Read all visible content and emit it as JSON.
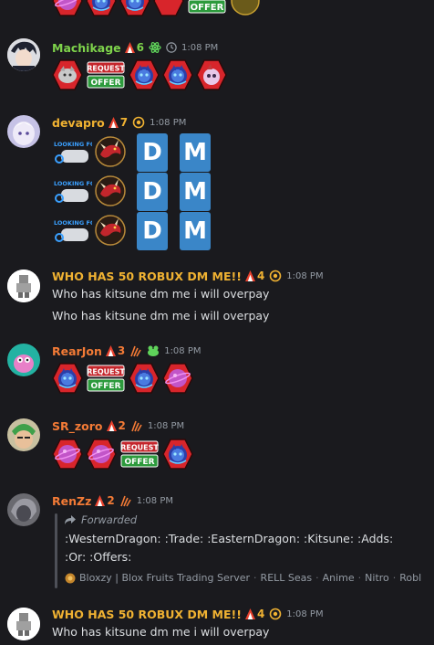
{
  "colors": {
    "background": "#1a1a1e",
    "green_user": "#7ed34b",
    "gold_user": "#f0b232",
    "orange_user": "#f47b36",
    "red_hex": "#d8252b",
    "dm_blue": "#3a86c8"
  },
  "top_row": {
    "offer_label": "OFFER"
  },
  "messages": [
    {
      "username": "Machikage",
      "level": "6",
      "time": "1:08 PM",
      "badges": [
        "atom-badge-icon",
        "clock-badge-icon"
      ],
      "emojis": [
        "fruit-emoji",
        "request-offer-emoji",
        "kitsune-emoji",
        "kitsune-emoji",
        "dough-emoji"
      ],
      "request_label": "REQUEST",
      "offer_label": "OFFER"
    },
    {
      "username": "devapro",
      "level": "7",
      "time": "1:08 PM",
      "lf_label": "LOOKING FOR",
      "dm_letters": [
        "D",
        "M"
      ]
    },
    {
      "username": "WHO HAS 50 ROBUX DM ME!!",
      "level": "4",
      "time": "1:08 PM",
      "line1": "Who has kitsune dm me i will overpay",
      "line2": "Who has kitsune dm me i will overpay"
    },
    {
      "username": "RearJon",
      "level": "3",
      "time": "1:08 PM",
      "request_label": "REQUEST",
      "offer_label": "OFFER"
    },
    {
      "username": "SR_zoro",
      "level": "2",
      "time": "1:08 PM",
      "request_label": "REQUEST",
      "offer_label": "OFFER"
    },
    {
      "username": "RenZz",
      "level": "2",
      "time": "1:08 PM",
      "forwarded_label": "Forwarded",
      "fwd_line1": ":WesternDragon: :Trade: :EasternDragon: :Kitsune: :Adds:",
      "fwd_line2": ":Or: :Offers:",
      "source": "Bloxzy | Blox Fruits Trading Server",
      "source_channel": "RELL Seas",
      "source_tag1": "Anime",
      "source_tag2": "Nitro",
      "source_tag3": "Robl"
    },
    {
      "username": "WHO HAS 50 ROBUX DM ME!!",
      "level": "4",
      "time": "1:08 PM",
      "line1": "Who has kitsune dm me i will overpay"
    }
  ]
}
